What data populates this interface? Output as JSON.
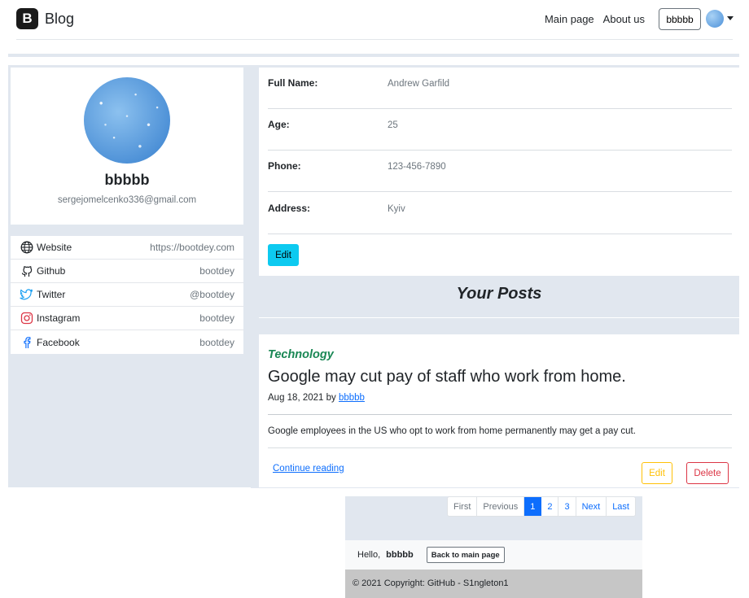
{
  "navbar": {
    "brand_logo": "B",
    "brand_text": "Blog",
    "links": [
      "Main page",
      "About us"
    ],
    "user_button": "bbbbb"
  },
  "profile": {
    "name": "bbbbb",
    "email": "sergejomelcenko336@gmail.com"
  },
  "social": [
    {
      "icon": "globe-icon",
      "label": "Website",
      "value": "https://bootdey.com"
    },
    {
      "icon": "github-icon",
      "label": "Github",
      "value": "bootdey"
    },
    {
      "icon": "twitter-icon",
      "label": "Twitter",
      "value": "@bootdey"
    },
    {
      "icon": "instagram-icon",
      "label": "Instagram",
      "value": "bootdey"
    },
    {
      "icon": "facebook-icon",
      "label": "Facebook",
      "value": "bootdey"
    }
  ],
  "details": [
    {
      "label": "Full Name:",
      "value": "Andrew Garfild"
    },
    {
      "label": "Age:",
      "value": "25"
    },
    {
      "label": "Phone:",
      "value": "123-456-7890"
    },
    {
      "label": "Address:",
      "value": "Kyiv"
    }
  ],
  "edit_button": "Edit",
  "posts_heading": "Your Posts",
  "post": {
    "category": "Technology",
    "title": "Google may cut pay of staff who work from home.",
    "date": "Aug 18, 2021 by",
    "author": "bbbbb",
    "excerpt": "Google employees in the US who opt to work from home permanently may get a pay cut.",
    "continue": "Continue reading",
    "edit": "Edit",
    "delete": "Delete"
  },
  "pagination": {
    "first": "First",
    "previous": "Previous",
    "pages": [
      "1",
      "2",
      "3"
    ],
    "active_page": "1",
    "next": "Next",
    "last": "Last"
  },
  "hello": {
    "text": "Hello,",
    "user": "bbbbb",
    "back_button": "Back to main page"
  },
  "footer": {
    "text": "© 2021 Copyright: GitHub - S1ngleton1"
  },
  "colors": {
    "accent_info": "#0dcaf0",
    "primary": "#0d6efd",
    "success": "#198754",
    "warning": "#ffc107",
    "danger": "#dc3545",
    "panel_bg": "#e1e7ef"
  }
}
